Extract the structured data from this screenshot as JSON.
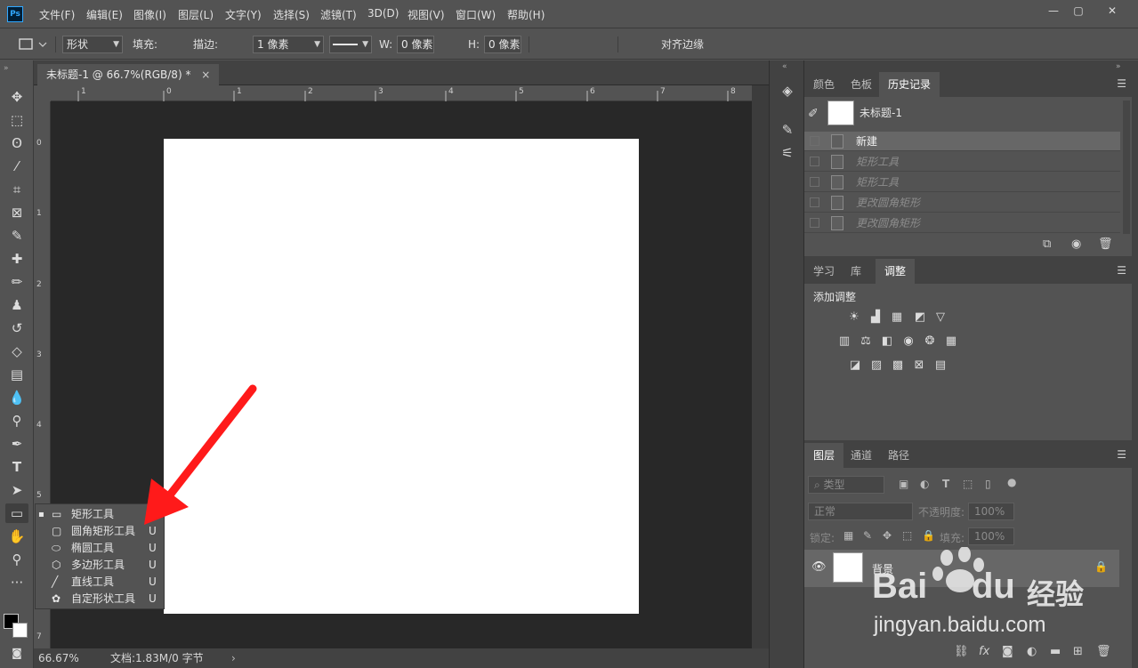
{
  "app": {
    "logo": "Ps",
    "accent": "#31a8ff"
  },
  "menu": [
    "文件(F)",
    "编辑(E)",
    "图像(I)",
    "图层(L)",
    "文字(Y)",
    "选择(S)",
    "滤镜(T)",
    "3D(D)",
    "视图(V)",
    "窗口(W)",
    "帮助(H)"
  ],
  "window_controls": {
    "minimize": "—",
    "maximize": "▢",
    "close": "✕"
  },
  "options_bar": {
    "mode": "形状",
    "fill_label": "填充:",
    "stroke_label": "描边:",
    "stroke_width": "1 像素",
    "w_label": "W:",
    "w_value": "0 像素",
    "h_label": "H:",
    "h_value": "0 像素",
    "align_edges": "对齐边缘",
    "fill_color": "#000000"
  },
  "document": {
    "tab_title": "未标题-1 @ 66.7%(RGB/8) *",
    "close": "×",
    "ruler_h": [
      "1",
      "0",
      "1",
      "2",
      "3",
      "4",
      "5",
      "6",
      "7",
      "8"
    ],
    "ruler_v": [
      "0",
      "1",
      "2",
      "3",
      "4",
      "5",
      "6",
      "7"
    ],
    "zoom": "66.67%",
    "doc_info": "文档:1.83M/0 字节",
    "canvas_color": "#ffffff"
  },
  "shape_flyout": [
    {
      "label": "矩形工具",
      "key": "U",
      "icon": "rectangle-icon",
      "selected": true
    },
    {
      "label": "圆角矩形工具",
      "key": "U",
      "icon": "rounded-rectangle-icon",
      "selected": false
    },
    {
      "label": "椭圆工具",
      "key": "U",
      "icon": "ellipse-icon",
      "selected": false
    },
    {
      "label": "多边形工具",
      "key": "U",
      "icon": "polygon-icon",
      "selected": false
    },
    {
      "label": "直线工具",
      "key": "U",
      "icon": "line-icon",
      "selected": false
    },
    {
      "label": "自定形状工具",
      "key": "U",
      "icon": "custom-shape-icon",
      "selected": false
    }
  ],
  "history_panel": {
    "tabs": [
      "颜色",
      "色板",
      "历史记录"
    ],
    "active_tab": "历史记录",
    "snapshot": "未标题-1",
    "states": [
      {
        "label": "新建",
        "current": true
      },
      {
        "label": "矩形工具",
        "current": false
      },
      {
        "label": "矩形工具",
        "current": false
      },
      {
        "label": "更改圆角矩形",
        "current": false
      },
      {
        "label": "更改圆角矩形",
        "current": false
      }
    ]
  },
  "adjustments_panel": {
    "tabs": [
      "学习",
      "库",
      "调整"
    ],
    "active_tab": "调整",
    "title": "添加调整"
  },
  "layers_panel": {
    "tabs": [
      "图层",
      "通道",
      "路径"
    ],
    "active_tab": "图层",
    "filter": "类型",
    "blend_mode": "正常",
    "opacity_label": "不透明度:",
    "opacity": "100%",
    "lock_label": "锁定:",
    "fill_label": "填充:",
    "fill": "100%",
    "layer_name": "背景"
  },
  "annotation": {
    "arrow_color": "#ff1a1a"
  },
  "watermark": {
    "brand": "Bai",
    "brand2": "du",
    "cn": "经验",
    "url": "jingyan.baidu.com"
  }
}
